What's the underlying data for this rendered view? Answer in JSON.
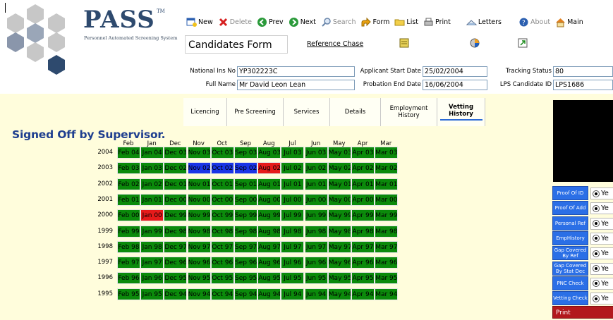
{
  "app": {
    "logo_name": "PASS",
    "logo_tm": "TM",
    "logo_subtitle": "Personnel Automated Screening System"
  },
  "toolbar": [
    {
      "label": "New",
      "icon": "new-record-icon",
      "disabled": false
    },
    {
      "label": "Delete",
      "icon": "delete-x-icon",
      "disabled": true
    },
    {
      "label": "Prev",
      "icon": "prev-arrow-icon",
      "disabled": false
    },
    {
      "label": "Next",
      "icon": "next-arrow-icon",
      "disabled": false
    },
    {
      "label": "Search",
      "icon": "search-magnifier-icon",
      "disabled": true
    },
    {
      "label": "Form",
      "icon": "form-arrow-icon",
      "disabled": false
    },
    {
      "label": "List",
      "icon": "folder-icon",
      "disabled": false
    },
    {
      "label": "Print",
      "icon": "printer-icon",
      "disabled": false
    },
    {
      "label": "Letters",
      "icon": "letters-icon",
      "disabled": false
    },
    {
      "label": "About",
      "icon": "help-icon",
      "disabled": true
    },
    {
      "label": "Main",
      "icon": "home-icon",
      "disabled": false
    }
  ],
  "form": {
    "title": "Candidates Form",
    "reference_chase": "Reference Chase"
  },
  "fields": {
    "ni_label": "National Ins No",
    "ni_value": "YP302223C",
    "fullname_label": "Full Name",
    "fullname_value": "Mr David Leon Lean",
    "start_label": "Applicant Start Date",
    "start_value": "25/02/2004",
    "probation_label": "Probation End Date",
    "probation_value": "16/06/2004",
    "tracking_label": "Tracking Status",
    "tracking_value": "80",
    "lps_label": "LPS Candidate ID",
    "lps_value": "LPS1686"
  },
  "tabs": [
    {
      "label": "Licencing",
      "active": false
    },
    {
      "label": "Pre Screening",
      "active": false
    },
    {
      "label": "Services",
      "active": false
    },
    {
      "label": "Details",
      "active": false
    },
    {
      "label": "Employment History",
      "active": false
    },
    {
      "label": "Vetting History",
      "active": true
    }
  ],
  "status_heading": "Signed Off by Supervisor.",
  "months": [
    "Feb",
    "Jan",
    "Dec",
    "Nov",
    "Oct",
    "Sep",
    "Aug",
    "Jul",
    "Jun",
    "May",
    "Apr",
    "Mar"
  ],
  "colors": {
    "green": "#0b8a0b",
    "blue": "#1a35e6",
    "red": "#e61a1a"
  },
  "grid": [
    {
      "year": "2004",
      "cells": [
        [
          "Feb 04",
          "g"
        ],
        [
          "Jan 04",
          "g"
        ],
        [
          "Dec 03",
          "g"
        ],
        [
          "Nov 03",
          "g"
        ],
        [
          "Oct 03",
          "g"
        ],
        [
          "Sep 03",
          "g"
        ],
        [
          "Aug 03",
          "g"
        ],
        [
          "Jul 03",
          "g"
        ],
        [
          "Jun 03",
          "g"
        ],
        [
          "May 03",
          "g"
        ],
        [
          "Apr 03",
          "g"
        ],
        [
          "Mar 03",
          "g"
        ]
      ]
    },
    {
      "year": "2003",
      "cells": [
        [
          "Feb 03",
          "g"
        ],
        [
          "Jan 03",
          "g"
        ],
        [
          "Dec 02",
          "g"
        ],
        [
          "Nov 02",
          "b"
        ],
        [
          "Oct 02",
          "b"
        ],
        [
          "Sep 02",
          "b"
        ],
        [
          "Aug 02",
          "r"
        ],
        [
          "Jul 02",
          "g"
        ],
        [
          "Jun 02",
          "g"
        ],
        [
          "May 02",
          "g"
        ],
        [
          "Apr 02",
          "g"
        ],
        [
          "Mar 02",
          "g"
        ]
      ]
    },
    {
      "year": "2002",
      "cells": [
        [
          "Feb 02",
          "g"
        ],
        [
          "Jan 02",
          "g"
        ],
        [
          "Dec 01",
          "g"
        ],
        [
          "Nov 01",
          "g"
        ],
        [
          "Oct 01",
          "g"
        ],
        [
          "Sep 01",
          "g"
        ],
        [
          "Aug 01",
          "g"
        ],
        [
          "Jul 01",
          "g"
        ],
        [
          "Jun 01",
          "g"
        ],
        [
          "May 01",
          "g"
        ],
        [
          "Apr 01",
          "g"
        ],
        [
          "Mar 01",
          "g"
        ]
      ]
    },
    {
      "year": "2001",
      "cells": [
        [
          "Feb 01",
          "g"
        ],
        [
          "Jan 01",
          "g"
        ],
        [
          "Dec 00",
          "g"
        ],
        [
          "Nov 00",
          "g"
        ],
        [
          "Oct 00",
          "g"
        ],
        [
          "Sep 00",
          "g"
        ],
        [
          "Aug 00",
          "g"
        ],
        [
          "Jul 00",
          "g"
        ],
        [
          "Jun 00",
          "g"
        ],
        [
          "May 00",
          "g"
        ],
        [
          "Apr 00",
          "g"
        ],
        [
          "Mar 00",
          "g"
        ]
      ]
    },
    {
      "year": "2000",
      "cells": [
        [
          "Feb 00",
          "g"
        ],
        [
          "Jan 00",
          "r"
        ],
        [
          "Dec 99",
          "g"
        ],
        [
          "Nov 99",
          "g"
        ],
        [
          "Oct 99",
          "g"
        ],
        [
          "Sep 99",
          "g"
        ],
        [
          "Aug 99",
          "g"
        ],
        [
          "Jul 99",
          "g"
        ],
        [
          "Jun 99",
          "g"
        ],
        [
          "May 99",
          "g"
        ],
        [
          "Apr 99",
          "g"
        ],
        [
          "Mar 99",
          "g"
        ]
      ]
    },
    {
      "year": "1999",
      "cells": [
        [
          "Feb 99",
          "g"
        ],
        [
          "Jan 99",
          "g"
        ],
        [
          "Dec 98",
          "g"
        ],
        [
          "Nov 98",
          "g"
        ],
        [
          "Oct 98",
          "g"
        ],
        [
          "Sep 98",
          "g"
        ],
        [
          "Aug 98",
          "g"
        ],
        [
          "Jul 98",
          "g"
        ],
        [
          "Jun 98",
          "g"
        ],
        [
          "May 98",
          "g"
        ],
        [
          "Apr 98",
          "g"
        ],
        [
          "Mar 98",
          "g"
        ]
      ]
    },
    {
      "year": "1998",
      "cells": [
        [
          "Feb 98",
          "g"
        ],
        [
          "Jan 98",
          "g"
        ],
        [
          "Dec 97",
          "g"
        ],
        [
          "Nov 97",
          "g"
        ],
        [
          "Oct 97",
          "g"
        ],
        [
          "Sep 97",
          "g"
        ],
        [
          "Aug 97",
          "g"
        ],
        [
          "Jul 97",
          "g"
        ],
        [
          "Jun 97",
          "g"
        ],
        [
          "May 97",
          "g"
        ],
        [
          "Apr 97",
          "g"
        ],
        [
          "Mar 97",
          "g"
        ]
      ]
    },
    {
      "year": "1997",
      "cells": [
        [
          "Feb 97",
          "g"
        ],
        [
          "Jan 97",
          "g"
        ],
        [
          "Dec 96",
          "g"
        ],
        [
          "Nov 96",
          "g"
        ],
        [
          "Oct 96",
          "g"
        ],
        [
          "Sep 96",
          "g"
        ],
        [
          "Aug 96",
          "g"
        ],
        [
          "Jul 96",
          "g"
        ],
        [
          "Jun 96",
          "g"
        ],
        [
          "May 96",
          "g"
        ],
        [
          "Apr 96",
          "g"
        ],
        [
          "Mar 96",
          "g"
        ]
      ]
    },
    {
      "year": "1996",
      "cells": [
        [
          "Feb 96",
          "g"
        ],
        [
          "Jan 96",
          "g"
        ],
        [
          "Dec 95",
          "g"
        ],
        [
          "Nov 95",
          "g"
        ],
        [
          "Oct 95",
          "g"
        ],
        [
          "Sep 95",
          "g"
        ],
        [
          "Aug 95",
          "g"
        ],
        [
          "Jul 95",
          "g"
        ],
        [
          "Jun 95",
          "g"
        ],
        [
          "May 95",
          "g"
        ],
        [
          "Apr 95",
          "g"
        ],
        [
          "Mar 95",
          "g"
        ]
      ]
    },
    {
      "year": "1995",
      "cells": [
        [
          "Feb 95",
          "g"
        ],
        [
          "Jan 95",
          "g"
        ],
        [
          "Dec 94",
          "g"
        ],
        [
          "Nov 94",
          "g"
        ],
        [
          "Oct 94",
          "g"
        ],
        [
          "Sep 94",
          "g"
        ],
        [
          "Aug 94",
          "g"
        ],
        [
          "Jul 94",
          "g"
        ],
        [
          "Jun 94",
          "g"
        ],
        [
          "May 94",
          "g"
        ],
        [
          "Apr 94",
          "g"
        ],
        [
          "Mar 94",
          "g"
        ]
      ]
    }
  ],
  "side_checks": [
    {
      "label": "Proof Of ID",
      "value": "Ye"
    },
    {
      "label": "Proof Of Add",
      "value": "Ye"
    },
    {
      "label": "Personal Ref",
      "value": "Ye"
    },
    {
      "label": "EmpHistory",
      "value": "Ye"
    },
    {
      "label": "Gap Covered By Ref",
      "value": "Ye"
    },
    {
      "label": "Gap Covered By Stat Dec",
      "value": "Ye"
    },
    {
      "label": "PNC Check",
      "value": "Ye"
    },
    {
      "label": "Vetting Check",
      "value": "Ye"
    }
  ],
  "print_documentation": "Print Documentation"
}
